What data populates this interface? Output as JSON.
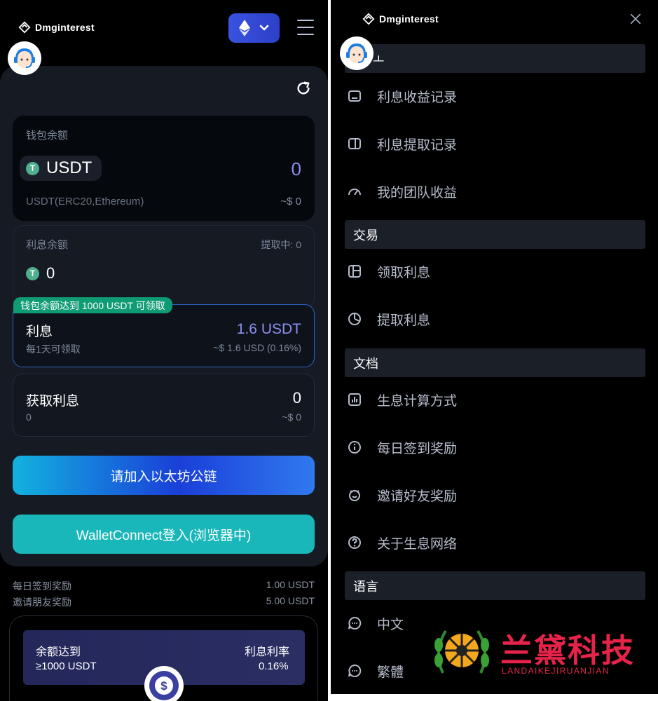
{
  "brand": {
    "name": "Dmginterest"
  },
  "left": {
    "wallet": {
      "label": "钱包余额",
      "token": "USDT",
      "amount": "0",
      "network": "USDT(ERC20,Ethereum)",
      "usd_value": "~$ 0"
    },
    "interest_balance": {
      "label": "利息余额",
      "withdrawing": "提取中: 0",
      "amount": "0"
    },
    "badge": "钱包余额达到 1000 USDT 可领取",
    "rate": {
      "title": "利息",
      "value": "1.6 USDT",
      "period": "每1天可领取",
      "usd": "~$ 1.6 USD (0.16%)"
    },
    "earned": {
      "title": "获取利息",
      "value": "0",
      "sub": "0",
      "usd": "~$ 0"
    },
    "join_button": "请加入以太坊公链",
    "walletconnect_button": "WalletConnect登入(浏览器中)",
    "rewards": [
      {
        "label": "每日签到奖励",
        "value": "1.00 USDT"
      },
      {
        "label": "邀请朋友奖励",
        "value": "5.00 USDT"
      }
    ],
    "tier": {
      "col1_header": "余额达到",
      "col2_header": "利息利率",
      "col1_value": "≥1000 USDT",
      "col2_value": "0.16%"
    }
  },
  "right": {
    "first_section_partial": "ㅗ",
    "sections": {
      "trade": "交易",
      "docs": "文档",
      "language": "语言"
    },
    "items": {
      "income_records": "利息收益记录",
      "withdraw_records": "利息提取记录",
      "team_income": "我的团队收益",
      "claim_interest": "领取利息",
      "withdraw_interest": "提取利息",
      "calc_method": "生息计算方式",
      "daily_checkin": "每日签到奖励",
      "invite_reward": "邀请好友奖励",
      "about_network": "关于生息网络",
      "lang_zh": "中文",
      "lang_tw": "繁體"
    }
  },
  "watermark": {
    "title": "兰黛科技",
    "subtitle": "LANDAIKEJIRUANJIAN"
  },
  "colors": {
    "accent_blue": "#2c40c8",
    "accent_teal": "#19b7b9",
    "badge_green": "#0f9b74",
    "watermark_red": "#e8234a"
  }
}
